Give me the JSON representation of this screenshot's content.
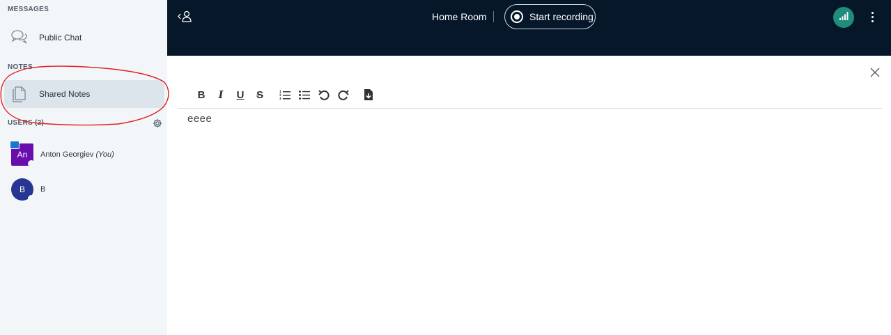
{
  "sidebar": {
    "messages_title": "MESSAGES",
    "public_chat_label": "Public Chat",
    "notes_title": "NOTES",
    "shared_notes_label": "Shared Notes",
    "users_title": "USERS (2)",
    "users": [
      {
        "initials": "An",
        "name": "Anton Georgiev",
        "suffix": "(You)",
        "color": "#6a0dad"
      },
      {
        "initials": "B",
        "name": "B",
        "suffix": "",
        "color": "#283593"
      }
    ]
  },
  "header": {
    "room_title": "Home Room",
    "record_label": "Start recording"
  },
  "notes": {
    "toolbar": [
      "bold-icon",
      "italic-icon",
      "underline-icon",
      "strikethrough-icon",
      "ordered-list-icon",
      "unordered-list-icon",
      "undo-icon",
      "redo-icon",
      "import-file-icon"
    ],
    "toolbar_glyphs": {
      "bold": "B",
      "italic": "I",
      "underline": "U",
      "strike": "S"
    },
    "content": "eeee"
  },
  "colors": {
    "header_bg": "#06172a",
    "sidebar_bg": "#f3f6f9",
    "active_item_bg": "#dce4ec",
    "connection_green": "#1f8c7e",
    "annotation_red": "#e02020"
  }
}
